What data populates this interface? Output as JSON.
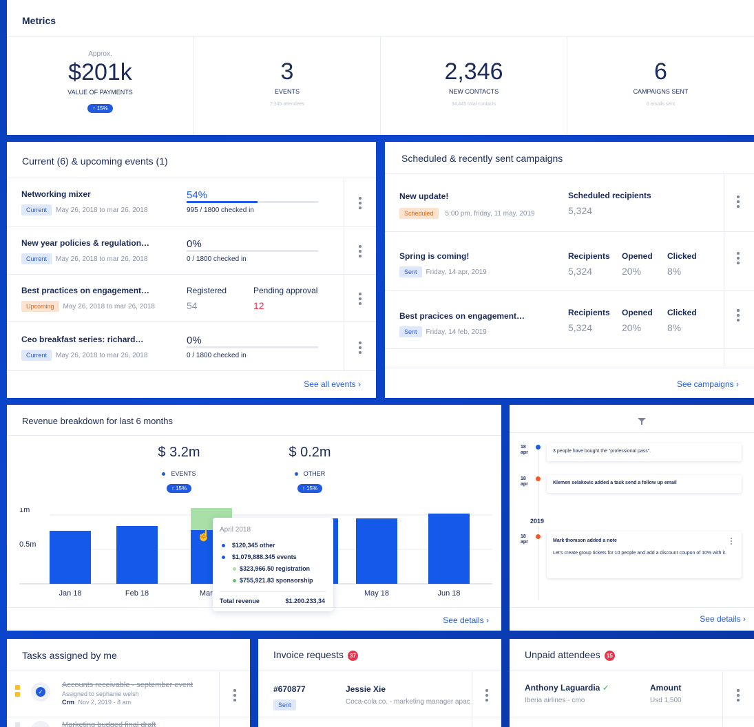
{
  "metrics": {
    "title": "Metrics",
    "items": [
      {
        "pre": "Approx.",
        "value": "$201k",
        "label": "VALUE OF PAYMENTS",
        "pill": "15%",
        "sub": ""
      },
      {
        "pre": "",
        "value": "3",
        "label": "EVENTS",
        "pill": "",
        "sub": "7,345 attendees"
      },
      {
        "pre": "",
        "value": "2,346",
        "label": "NEW CONTACTS",
        "pill": "",
        "sub": "34,445 total contacts"
      },
      {
        "pre": "",
        "value": "6",
        "label": "CAMPAIGNS SENT",
        "pill": "",
        "sub": "6 emails sent"
      }
    ]
  },
  "events": {
    "title": "Current (6) & upcoming events (1)",
    "rows": [
      {
        "name": "Networking mixer",
        "badge": "Current",
        "dates": "May 26, 2018 to mar 26, 2018",
        "pct": "54%",
        "progress": 0.54,
        "checked": "995 / 1800 checked in"
      },
      {
        "name": "New year policies & regulation…",
        "badge": "Current",
        "dates": "May 26, 2018 to mar 26, 2018",
        "pct": "0%",
        "progress": 0,
        "checked": "0 / 1800 checked in"
      },
      {
        "name": "Best practices on engagement…",
        "badge": "Upcoming",
        "dates": "May 26, 2018 to mar 26, 2018",
        "registered_label": "Registered",
        "registered": "54",
        "pending_label": "Pending approval",
        "pending": "12"
      },
      {
        "name": "Ceo breakfast series: richard…",
        "badge": "Current",
        "dates": "May 26, 2018 to mar 26, 2018",
        "pct": "0%",
        "progress": 0,
        "checked": "0 / 1800 checked in"
      }
    ],
    "see_all": "See all events"
  },
  "campaigns": {
    "title": "Scheduled & recently sent campaigns",
    "rows": [
      {
        "name": "New update!",
        "badge": "Scheduled",
        "date": "5:00 pm, friday, 11 may, 2019",
        "col1_label": "Scheduled recipients",
        "col1": "5,324"
      },
      {
        "name": "Spring is coming!",
        "badge": "Sent",
        "date": "Friday, 14 apr, 2019",
        "col1_label": "Recipients",
        "col1": "5,324",
        "col2_label": "Opened",
        "col2": "20%",
        "col3_label": "Clicked",
        "col3": "8%"
      },
      {
        "name": "Best pracices on engagement…",
        "badge": "Sent",
        "date": "Friday, 14 feb, 2019",
        "col1_label": "Recipients",
        "col1": "5,324",
        "col2_label": "Opened",
        "col2": "20%",
        "col3_label": "Clicked",
        "col3": "8%"
      }
    ],
    "see_all": "See campaigns"
  },
  "revenue": {
    "title": "Revenue breakdown for last 6 months",
    "totals": [
      {
        "amount": "$ 3.2m",
        "label": "EVENTS",
        "pill": "15%"
      },
      {
        "amount": "$ 0.2m",
        "label": "OTHER",
        "pill": "15%"
      }
    ],
    "tooltip": {
      "month": "April 2018",
      "lines": [
        {
          "text": "$120,345 other",
          "indent": false,
          "dot": "#1f5ae0"
        },
        {
          "text": "$1,079,888.345 events",
          "indent": false,
          "dot": "#1f5ae0"
        },
        {
          "text": "$323,966.50 registration",
          "indent": true,
          "dot": "#a8e0a8"
        },
        {
          "text": "$755,921.83 sponsorship",
          "indent": true,
          "dot": "#6cc36c"
        }
      ],
      "total_label": "Total revenue",
      "total_value": "$1.200.233,34"
    },
    "see_details": "See details"
  },
  "chart_data": {
    "type": "bar",
    "categories": [
      "Jan 18",
      "Feb 18",
      "Mar 18",
      "Apr 18",
      "May 18",
      "Jun 18"
    ],
    "series": [
      {
        "name": "events",
        "values": [
          0.75,
          0.82,
          0.78,
          0.95,
          0.95,
          1.02
        ]
      },
      {
        "name": "registration",
        "values": [
          0,
          0,
          0.32,
          0,
          0,
          0
        ]
      },
      {
        "name": "other",
        "values": [
          0.02,
          0.02,
          0.12,
          0,
          0,
          0
        ]
      }
    ],
    "y_ticks": [
      "0.5m",
      "1m"
    ],
    "ylim": [
      0,
      1.2
    ]
  },
  "activity": {
    "items": [
      {
        "day": "18",
        "month": "apr",
        "dot": "#1f5ae0",
        "text": "3 people have bought the “professional pass”.",
        "bold": false
      },
      {
        "day": "18",
        "month": "apr",
        "dot": "#f05a28",
        "text": "Klemen selakovic added a task send a follow up email",
        "bold": true
      }
    ],
    "year": "2019",
    "note": {
      "day": "18",
      "month": "apr",
      "title": "Mark thomson added a note",
      "body": "Let's create group tickets for 10 people and add a discount coupon of 10% with it."
    },
    "see_details": "See details"
  },
  "tasks": {
    "title": "Tasks assigned by me",
    "rows": [
      {
        "title": "Accounts receivable - september event",
        "assigned": "Assigned to sephanie welsh",
        "tag": "Crm",
        "date": "Nov 2, 2019 - 8 am"
      },
      {
        "title": "Marketing budged final draft"
      }
    ]
  },
  "invoices": {
    "title": "Invoice requests",
    "count": "37",
    "rows": [
      {
        "id": "#670877",
        "badge": "Sent",
        "name": "Jessie Xie",
        "detail": "Coca-cola co. - marketing manager apac"
      }
    ]
  },
  "unpaid": {
    "title": "Unpaid attendees",
    "count": "15",
    "rows": [
      {
        "name": "Anthony Laguardia",
        "company": "Iberia airlines - cmo",
        "amount_label": "Amount",
        "amount": "Usd 1,500"
      }
    ]
  }
}
